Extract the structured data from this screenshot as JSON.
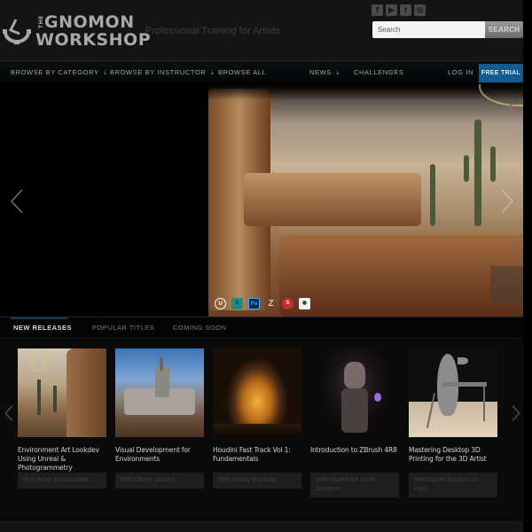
{
  "brand": {
    "logo_small": "THE",
    "logo_line1": "GNOMON",
    "logo_line2": "WORKSHOP",
    "tagline": "Professional Training for Artists"
  },
  "social": [
    {
      "name": "facebook-icon",
      "glyph": "f"
    },
    {
      "name": "youtube-icon",
      "glyph": "▶"
    },
    {
      "name": "twitter-icon",
      "glyph": "t"
    },
    {
      "name": "instagram-icon",
      "glyph": "◎"
    }
  ],
  "search": {
    "placeholder": "Search",
    "button_label": "SEARCH"
  },
  "nav": {
    "browse_category": "BROWSE BY CATEGORY",
    "browse_instructor": "BROWSE BY INSTRUCTOR",
    "browse_all": "BROWSE ALL",
    "news": "NEWS",
    "challenges": "CHALLENGES",
    "login": "LOG IN",
    "free_trial": "FREE TRIAL",
    "dropdown_glyph": "⇣",
    "accent_color": "#145a8c"
  },
  "hero": {
    "tools": [
      "Unreal Engine",
      "Substance Designer",
      "Photoshop",
      "ZBrush",
      "Substance Painter",
      "Houdini"
    ],
    "tool_glyphs": [
      "U",
      "S",
      "Ps",
      "Z",
      "S",
      "◉"
    ]
  },
  "tabs": [
    {
      "label": "NEW RELEASES",
      "active": true
    },
    {
      "label": "POPULAR TITLES",
      "active": false
    },
    {
      "label": "COMING SOON",
      "active": false
    }
  ],
  "courses": [
    {
      "title": "Environment Art Lookdev Using Unreal & Photogrammetry",
      "author": "With Brian Recktenwald"
    },
    {
      "title": "Visual Development for Environments",
      "author": "With Olivier Dubard"
    },
    {
      "title": "Houdini Fast Track Vol 1: Fundamentals",
      "author": "With Robby Branham"
    },
    {
      "title": "Introduction to ZBrush 4R8",
      "author": "With Madeleine Scott-Spencer"
    },
    {
      "title": "Mastering Desktop 3D Printing for the 3D Artist",
      "author": "With Daniel Enrique De Leon"
    }
  ]
}
